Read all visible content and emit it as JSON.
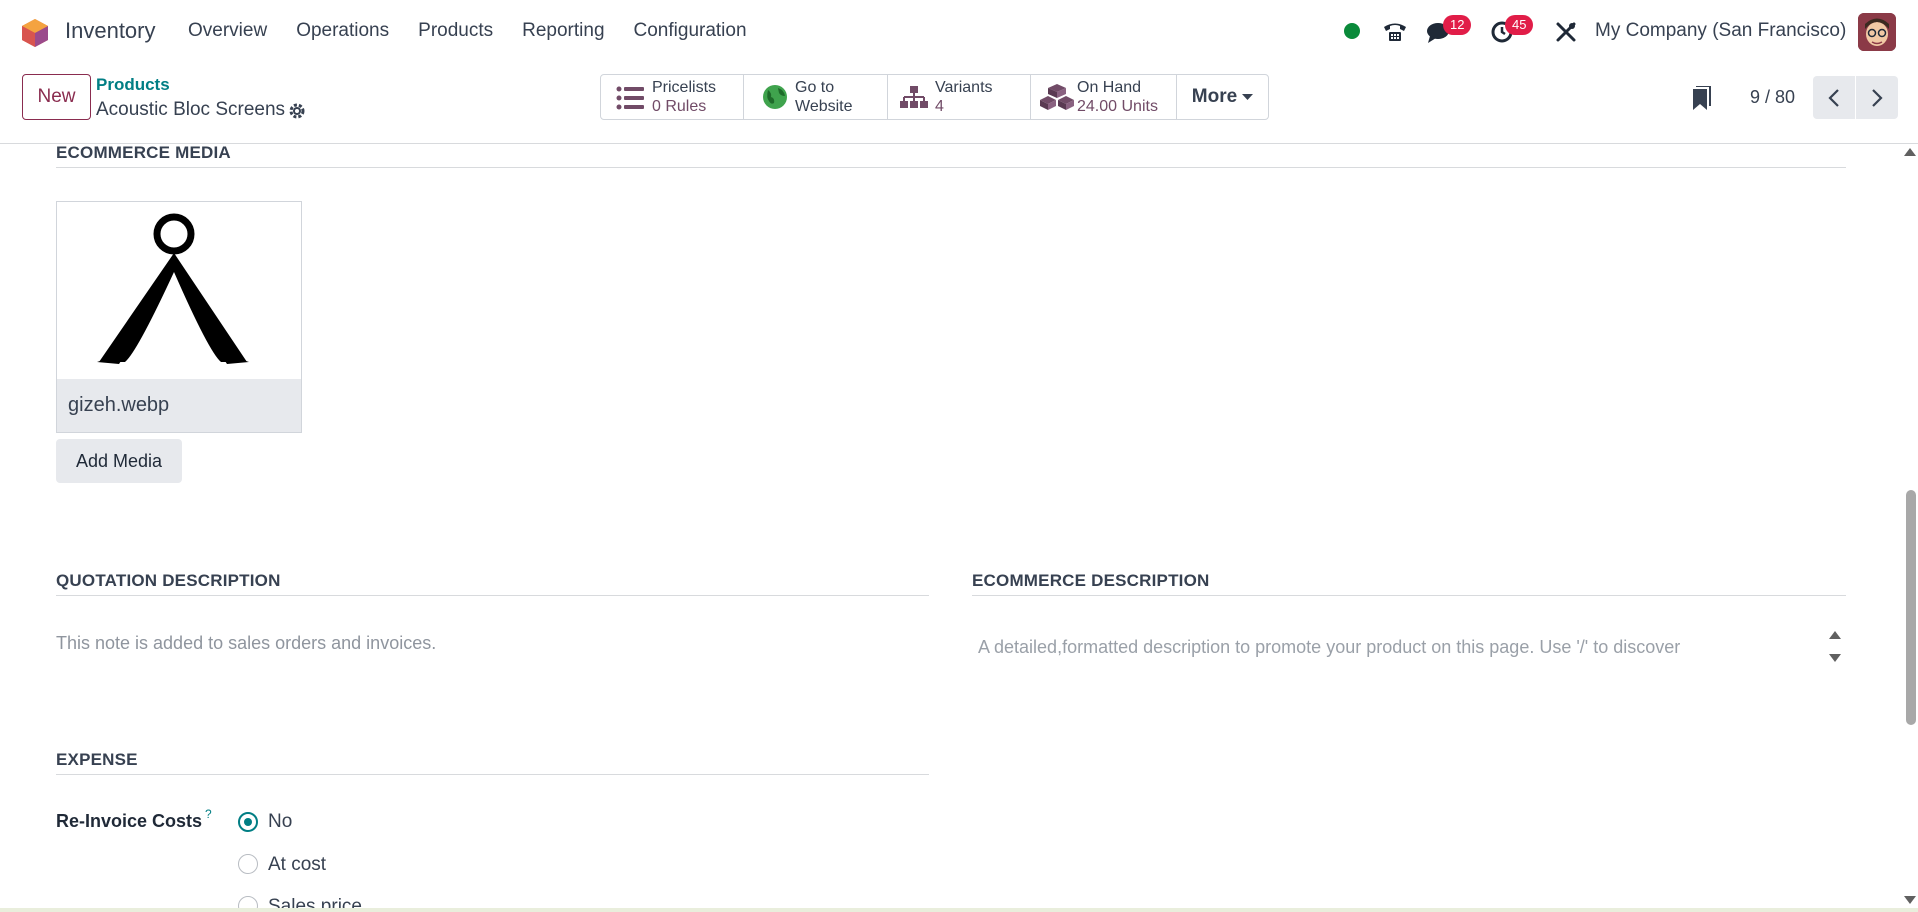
{
  "navbar": {
    "app_name": "Inventory",
    "menu": [
      "Overview",
      "Operations",
      "Products",
      "Reporting",
      "Configuration"
    ],
    "messages_count": "12",
    "activities_count": "45",
    "company": "My Company (San Francisco)"
  },
  "control_panel": {
    "new_label": "New",
    "breadcrumb_parent": "Products",
    "record_title": "Acoustic Bloc Screens",
    "smart_buttons": [
      {
        "line1": "Pricelists",
        "line2": "0 Rules",
        "icon": "list-icon"
      },
      {
        "line1": "Go to",
        "line2": "Website",
        "icon": "globe-icon"
      },
      {
        "line1": "Variants",
        "line2": "4",
        "icon": "sitemap-icon"
      },
      {
        "line1": "On Hand",
        "line2": "24.00 Units",
        "icon": "cubes-icon"
      }
    ],
    "more_label": "More",
    "pager": "9 / 80"
  },
  "ecommerce_media": {
    "title": "ECOMMERCE MEDIA",
    "file_name": "gizeh.webp",
    "add_media_label": "Add Media"
  },
  "quotation_description": {
    "title": "QUOTATION DESCRIPTION",
    "placeholder": "This note is added to sales orders and invoices."
  },
  "ecommerce_description": {
    "title": "ECOMMERCE DESCRIPTION",
    "placeholder": "A detailed,formatted description to promote your product on this page. Use '/' to discover"
  },
  "expense": {
    "title": "EXPENSE",
    "field_label": "Re-Invoice Costs",
    "help_mark": "?",
    "options": [
      "No",
      "At cost",
      "Sales price"
    ],
    "selected": "No"
  },
  "colors": {
    "brand": "#714b67",
    "accent": "#017e84",
    "badge": "#e11d48",
    "presence": "#0a8a3a"
  }
}
